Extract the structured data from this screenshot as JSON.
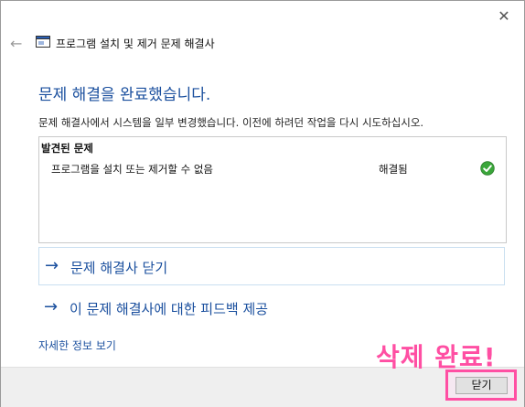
{
  "window": {
    "title": "프로그램 설치 및 제거 문제 해결사",
    "close_glyph": "✕",
    "back_glyph": "←"
  },
  "main": {
    "heading": "문제 해결을 완료했습니다.",
    "description": "문제 해결사에서 시스템을 일부 변경했습니다. 이전에 하려던 작업을 다시 시도하십시오.",
    "problems": {
      "header": "발견된 문제",
      "items": [
        {
          "name": "프로그램을 설치 또는 제거할 수 없음",
          "status": "해결됨",
          "icon": "check-icon"
        }
      ]
    },
    "links": {
      "close_troubleshooter": "문제 해결사 닫기",
      "feedback": "이 문제 해결사에 대한 피드백 제공",
      "arrow_glyph": "→"
    },
    "details_link": "자세한 정보 보기"
  },
  "footer": {
    "close_button": "닫기"
  },
  "annotation": {
    "text": "삭제 완료!",
    "color": "#ff4fa3"
  },
  "colors": {
    "accent": "#1a4f9e",
    "success": "#3aa63a"
  }
}
